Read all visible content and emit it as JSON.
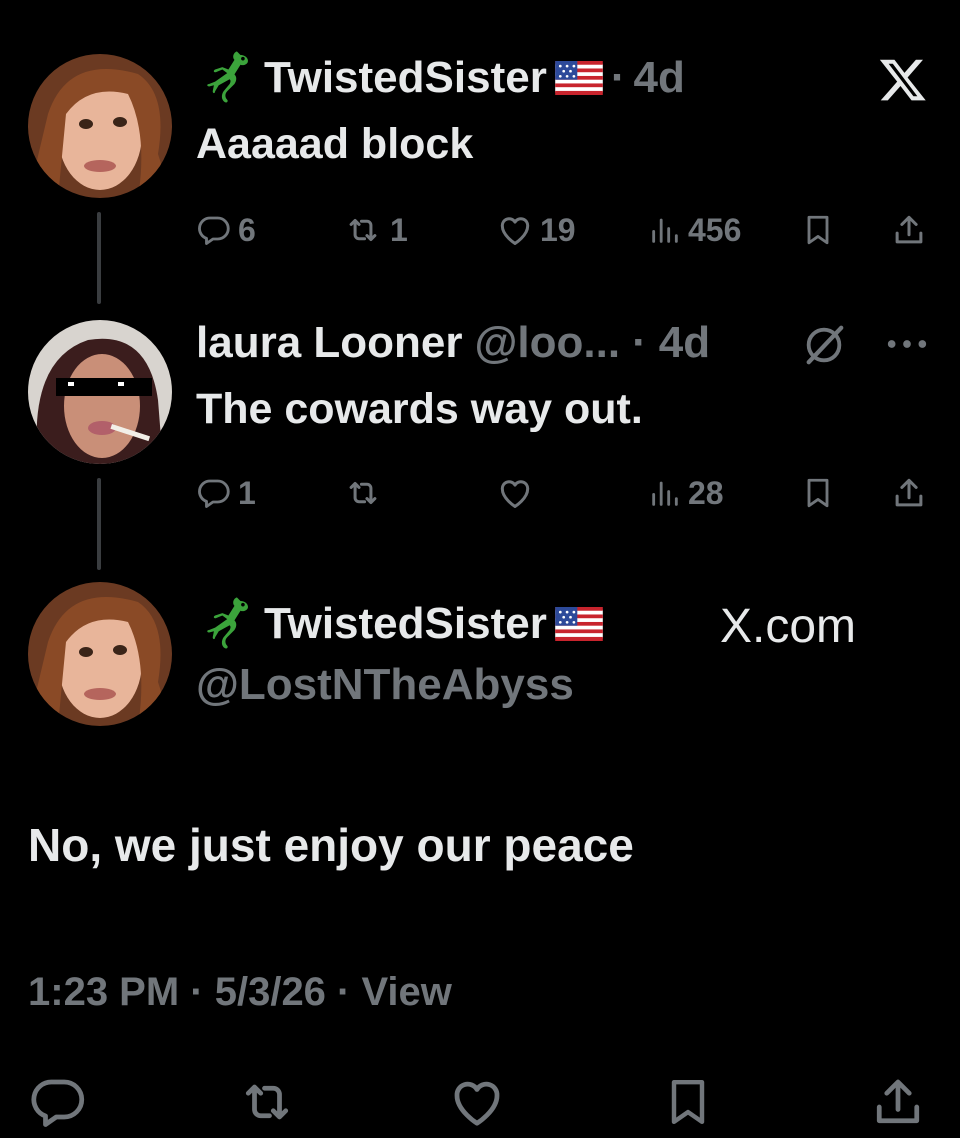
{
  "tweet1": {
    "display_name": "TwistedSister",
    "dot": "·",
    "time": "4d",
    "text": "Aaaaad block",
    "replies": "6",
    "retweets": "1",
    "likes": "19",
    "views": "456"
  },
  "tweet2": {
    "display_name": "laura Looner",
    "handle": "@loo...",
    "dot": "·",
    "time": "4d",
    "text": "The cowards way out.",
    "replies": "1",
    "views": "28"
  },
  "main_tweet": {
    "display_name": "TwistedSister",
    "handle": "@LostNTheAbyss",
    "watermark": "X.com",
    "text": "No, we just enjoy our peace",
    "timestamp": "1:23 PM · 5/3/26 · View"
  },
  "icons": {
    "gecko": "gecko-emoji",
    "flag": "us-flag-emoji",
    "reply": "reply-icon",
    "retweet": "retweet-icon",
    "like": "like-icon",
    "views": "views-icon",
    "bookmark": "bookmark-icon",
    "share": "share-icon"
  },
  "colors": {
    "background": "#000000",
    "text": "#e7e9ea",
    "muted": "#71767b",
    "thread_line": "#3a3d40",
    "gecko": "#3ba33b"
  }
}
